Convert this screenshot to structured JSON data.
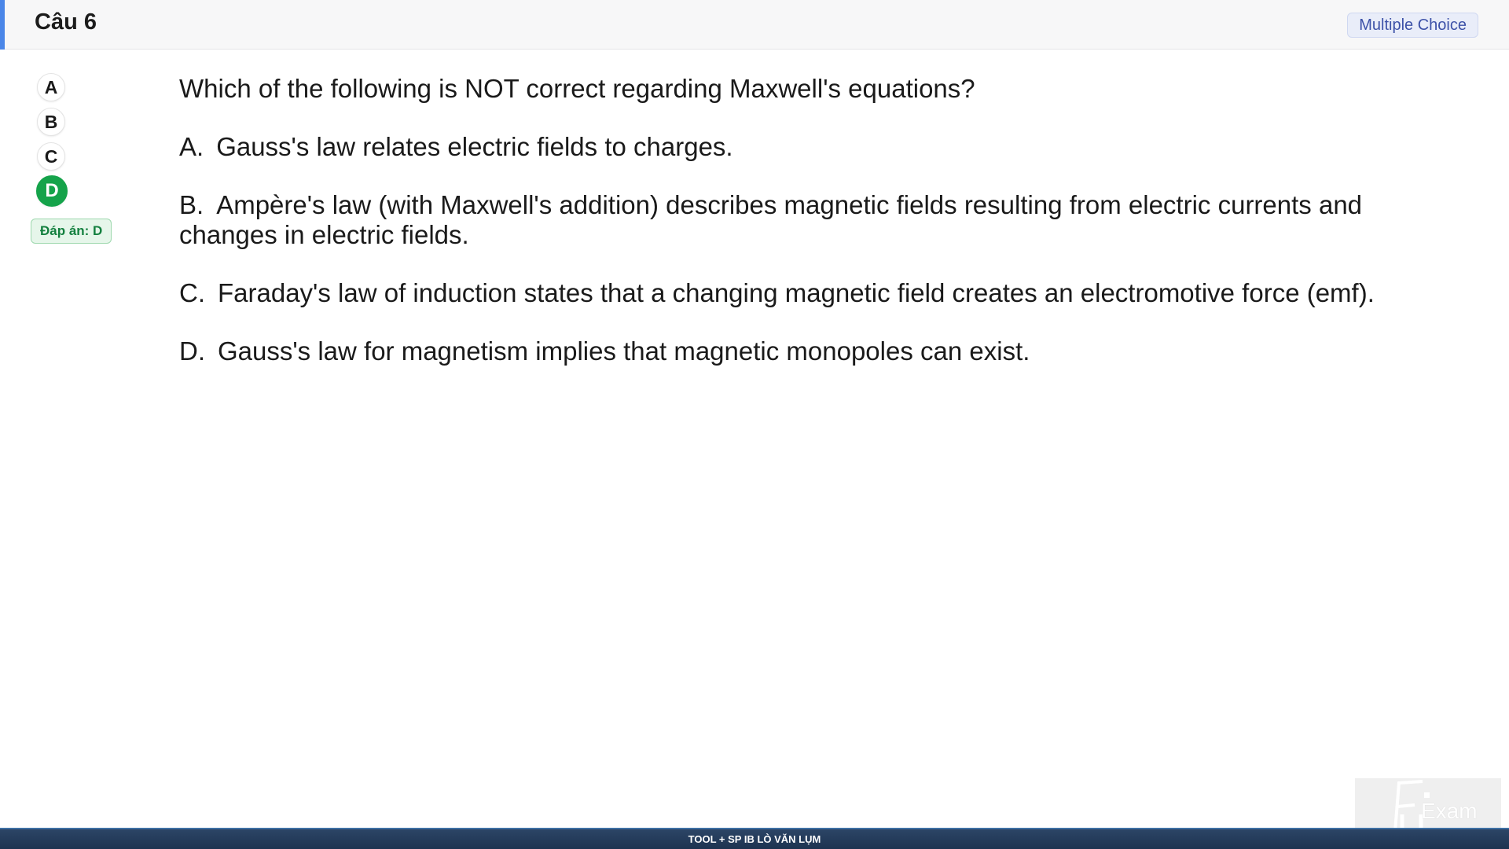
{
  "header": {
    "title": "Câu 6",
    "type_badge": "Multiple Choice"
  },
  "options_nav": {
    "items": [
      {
        "letter": "A",
        "selected": false
      },
      {
        "letter": "B",
        "selected": false
      },
      {
        "letter": "C",
        "selected": false
      },
      {
        "letter": "D",
        "selected": true
      }
    ],
    "answer_badge": "Đáp án: D"
  },
  "question": {
    "text": "Which of the following is NOT correct regarding Maxwell's equations?",
    "options": [
      {
        "letter": "A.",
        "text": "Gauss's law relates electric fields to charges."
      },
      {
        "letter": "B.",
        "text": "Ampère's law (with Maxwell's addition) describes magnetic fields resulting from electric currents and changes in electric fields."
      },
      {
        "letter": "C.",
        "text": "Faraday's law of induction states that a changing magnetic field creates an electromotive force (emf)."
      },
      {
        "letter": "D.",
        "text": "Gauss's law for magnetism implies that magnetic monopoles can exist."
      }
    ]
  },
  "watermark": {
    "logo_text": "Exam"
  },
  "footer": {
    "text": "TOOL + SP IB LÒ VĂN LỤM"
  },
  "colors": {
    "accent": "#4a86e8",
    "selected_green": "#15a34a",
    "footer_bg": "#1d3350"
  }
}
